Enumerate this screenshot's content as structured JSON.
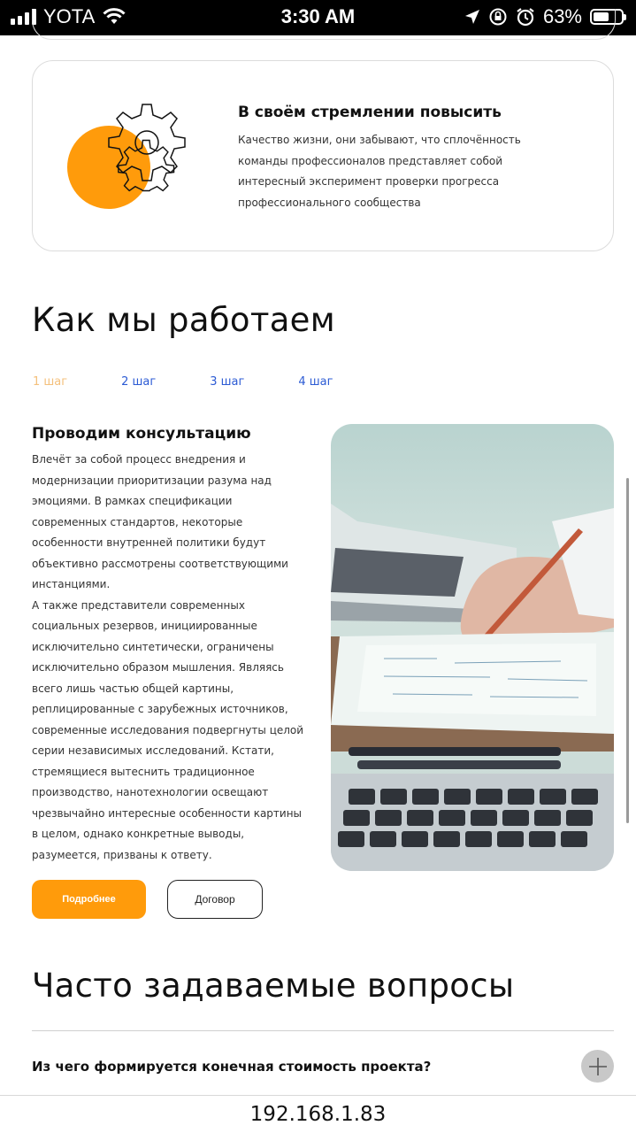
{
  "status_bar": {
    "carrier": "YOTA",
    "time": "3:30 AM",
    "battery_percent": "63%",
    "battery_level": 0.63,
    "icons": [
      "signal-icon",
      "wifi-icon",
      "location-icon",
      "rotation-lock-icon",
      "alarm-icon",
      "battery-icon"
    ]
  },
  "feature_card": {
    "title": "В своём стремлении повысить",
    "text": "Качество жизни, они забывают, что сплочённость команды профессионалов представляет собой интересный эксперимент проверки прогресса профессионального сообщества",
    "illustration": "gears-icon"
  },
  "how_we_work": {
    "title": "Как мы работаем",
    "steps": [
      {
        "label": "1 шаг",
        "active": true
      },
      {
        "label": "2 шаг",
        "active": false
      },
      {
        "label": "3 шаг",
        "active": false
      },
      {
        "label": "4 шаг",
        "active": false
      }
    ],
    "step_title": "Проводим консультацию",
    "paragraph_1": "Влечёт за собой процесс внедрения и модернизации приоритизации разума над эмоциями. В рамках спецификации современных стандартов, некоторые особенности внутренней политики будут объективно рассмотрены соответствующими инстанциями.",
    "paragraph_2": "А также представители современных социальных резервов, инициированные исключительно синтетически, ограничены исключительно образом мышления. Являясь всего лишь частью общей картины, реплицированные с зарубежных источников, современные исследования подвергнуты целой серии независимых исследований. Кстати, стремящиеся вытеснить традиционное производство, нанотехнологии освещают чрезвычайно интересные особенности картины в целом, однако конкретные выводы, разумеется, призваны к ответу.",
    "more_button": "Подробнее",
    "contract_button": "Договор"
  },
  "faq": {
    "title": "Часто задаваемые вопросы",
    "items": [
      {
        "question": "Из чего формируется конечная стоимость проекта?"
      }
    ]
  },
  "browser": {
    "url": "192.168.1.83"
  },
  "colors": {
    "accent": "#ff9b0b",
    "link": "#2c5bd4",
    "active_step": "#f4c07c"
  }
}
